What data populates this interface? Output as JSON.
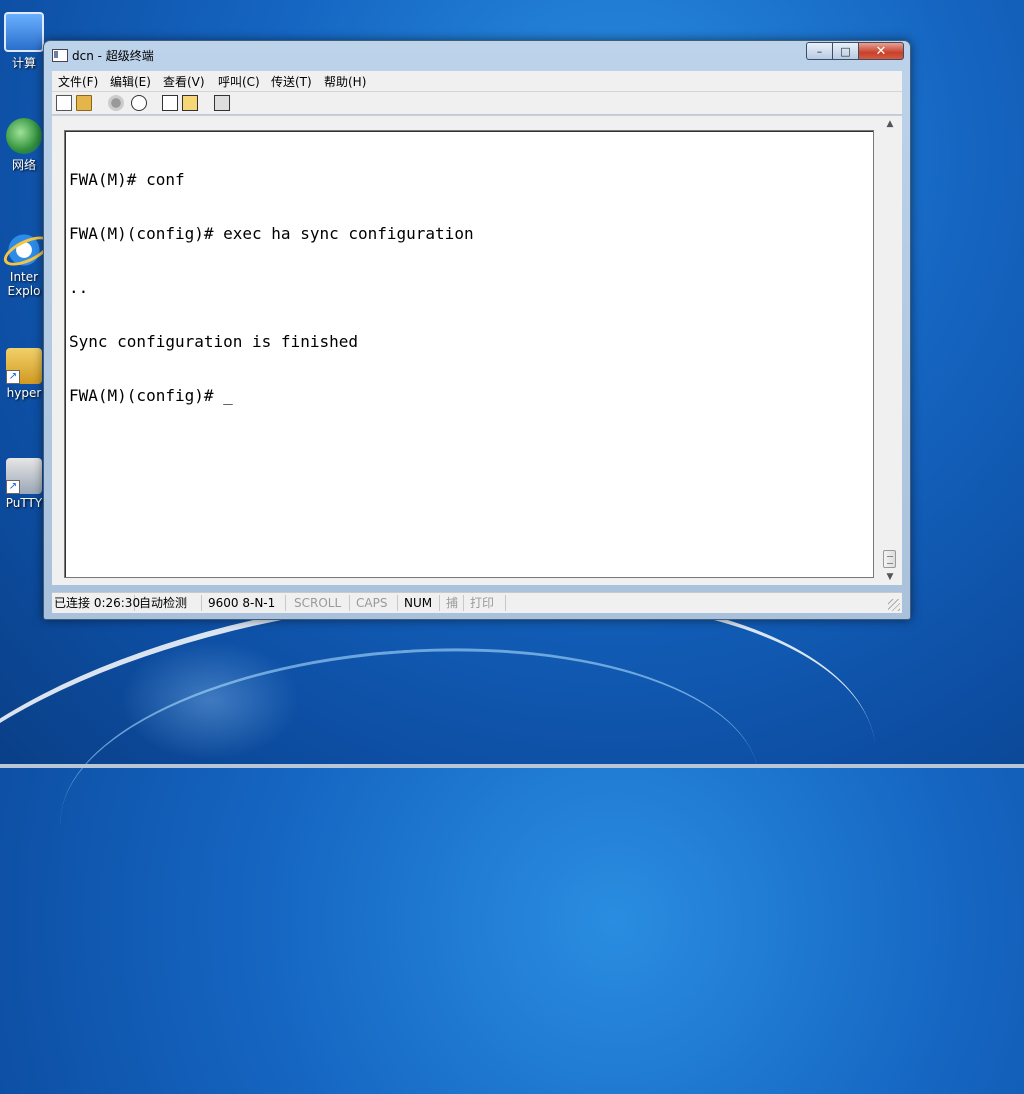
{
  "desktop": {
    "icons": [
      {
        "label": "计算",
        "icon": "computer-icon"
      },
      {
        "label": "网络",
        "icon": "network-icon"
      },
      {
        "label": "Inter",
        "label2": "Explo",
        "icon": "internet-explorer-icon"
      },
      {
        "label": "hyper",
        "icon": "hyperterminal-icon"
      },
      {
        "label": "PuTTY",
        "icon": "putty-icon"
      }
    ]
  },
  "window": {
    "title": "dcn - 超级终端",
    "buttons": {
      "minimize": "–",
      "maximize": "□",
      "close": "✕"
    },
    "menu": [
      "文件(F)",
      "编辑(E)",
      "查看(V)",
      "呼叫(C)",
      "传送(T)",
      "帮助(H)"
    ],
    "toolbar": [
      "new-icon",
      "open-icon",
      "disconnect-icon",
      "connect-icon",
      "send-icon",
      "receive-icon",
      "properties-icon"
    ],
    "terminal": {
      "lines": [
        "FWA(M)# conf",
        "FWA(M)(config)# exec ha sync configuration",
        "..",
        "Sync configuration is finished",
        "FWA(M)(config)# _"
      ]
    },
    "status": {
      "connected": "已连接 0:26:30",
      "detect": "自动检测",
      "baud": "9600 8-N-1",
      "scroll": "SCROLL",
      "caps": "CAPS",
      "num": "NUM",
      "capture": "捕",
      "print": "打印"
    }
  }
}
